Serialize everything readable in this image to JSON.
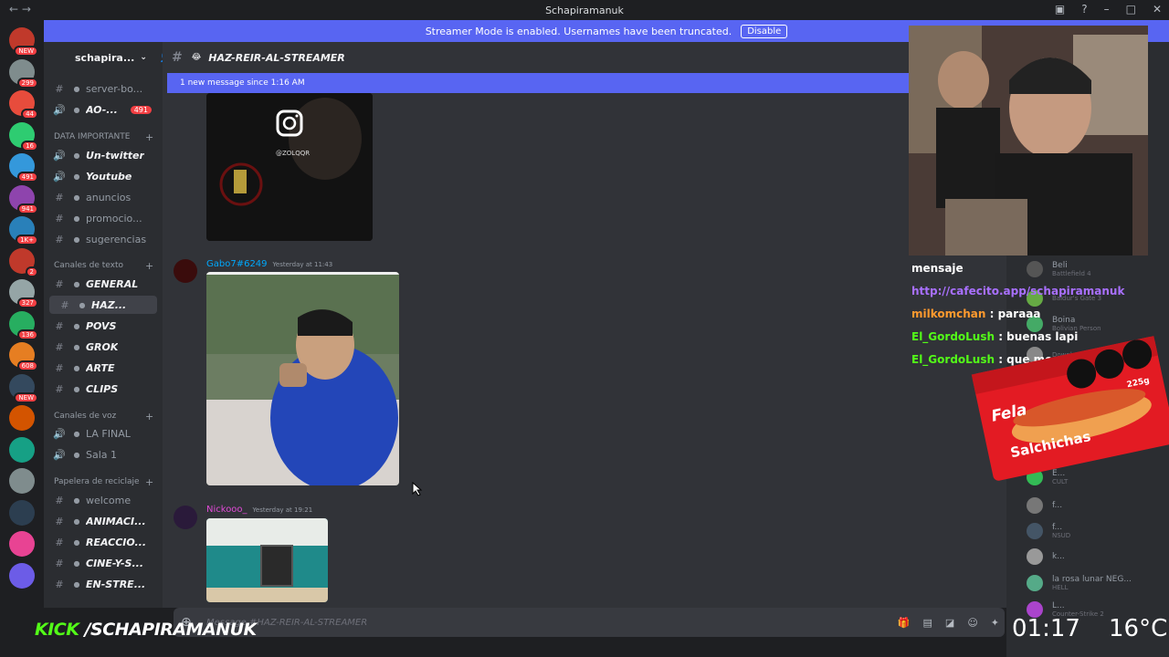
{
  "window": {
    "title": "Schapiramanuk"
  },
  "banner": {
    "text": "Streamer Mode is enabled. Usernames have been truncated.",
    "button": "Disable"
  },
  "guild": {
    "name": "schapira..."
  },
  "channels": {
    "top": [
      {
        "label": "server-bo...",
        "icon": "hash",
        "bold": false
      },
      {
        "label": "AO-...",
        "icon": "speaker",
        "bold": true,
        "badge": "491"
      }
    ],
    "cat1": "DATA IMPORTANTE",
    "group1": [
      {
        "label": "Un-twitter",
        "bold": true
      },
      {
        "label": "Youtube",
        "bold": true
      },
      {
        "label": "anuncios",
        "bold": false
      },
      {
        "label": "promocio...",
        "bold": false
      },
      {
        "label": "sugerencias",
        "bold": false
      }
    ],
    "cat2": "Canales de texto",
    "group2": [
      {
        "label": "GENERAL",
        "bold": true
      },
      {
        "label": "HAZ...",
        "bold": true,
        "active": true
      },
      {
        "label": "POVS",
        "bold": true
      },
      {
        "label": "GROK",
        "bold": true
      },
      {
        "label": "ARTE",
        "bold": true
      },
      {
        "label": "CLIPS",
        "bold": true
      }
    ],
    "cat3": "Canales de voz",
    "group3": [
      {
        "label": "LA FINAL"
      },
      {
        "label": "Sala 1"
      }
    ],
    "cat4": "Papelera de reciclaje",
    "group4": [
      {
        "label": "welcome",
        "bold": false
      },
      {
        "label": "ANIMACI...",
        "bold": true
      },
      {
        "label": "REACCIO...",
        "bold": true
      },
      {
        "label": "CINE-Y-S...",
        "bold": true
      },
      {
        "label": "EN-STRE...",
        "bold": true
      }
    ]
  },
  "channel_header": {
    "name": "HAZ-REIR-AL-STREAMER"
  },
  "new_messages": {
    "text": "1 new message since 1:16 AM"
  },
  "messages": [
    {
      "author": "Gabo7#6249",
      "time": "Yesterday at 11:43",
      "author_color": "#00a8fc"
    },
    {
      "author": "Nickooo_",
      "time": "Yesterday at 19:21",
      "author_color": "#e04ad6"
    }
  ],
  "embed_watermark": "@ZOLQQR",
  "composer": {
    "placeholder": "Message #HAZ-REIR-AL-STREAMER"
  },
  "server_badges": [
    "NEW",
    "299",
    "44",
    "16",
    "491",
    "941",
    "1K+",
    "2",
    "327",
    "136",
    "608",
    "NEW"
  ],
  "members": [
    {
      "name": "Beli",
      "activity": "Battlefield 4"
    },
    {
      "name": "",
      "activity": "Baldur's Gate 3"
    },
    {
      "name": "Boina",
      "activity": "Bolivian Person"
    },
    {
      "name": "",
      "activity": "Download"
    },
    {
      "name": "E...",
      "activity": "CULT"
    },
    {
      "name": "f...",
      "activity": ""
    },
    {
      "name": "f...",
      "activity": "NSUD"
    },
    {
      "name": "k...",
      "activity": ""
    },
    {
      "name": "la rosa lunar NEG...",
      "activity": "HELL"
    },
    {
      "name": "L...",
      "activity": "Counter-Strike 2"
    }
  ],
  "stream_chat": [
    {
      "user": "",
      "text": "mensaje",
      "color": "#ffffff"
    },
    {
      "user": "",
      "text": "http://cafecito.app/schapiramanuk",
      "color": "#a970ff"
    },
    {
      "user": "milkomchan",
      "text": " : paraaa",
      "color": "#ff9a2e"
    },
    {
      "user": "El_GordoLush",
      "text": " : buenas lapi",
      "color": "#53fc18"
    },
    {
      "user": "El_GordoLush",
      "text": " : que me perdi",
      "color": "#53fc18"
    }
  ],
  "overlay": {
    "kick_brand": "KICK",
    "kick_handle": "/SCHAPIRAMANUK",
    "clock": "01:17",
    "temperature": "16°C"
  },
  "ad": {
    "brand": "Fela",
    "product": "Salchichas",
    "weight": "225g"
  }
}
